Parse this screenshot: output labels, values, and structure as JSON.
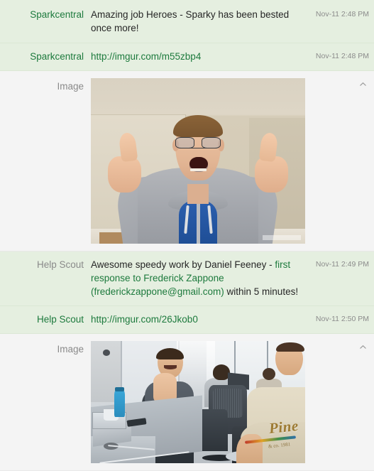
{
  "feed": {
    "rows": [
      {
        "type": "text",
        "source": "Sparkcentral",
        "source_color": "green",
        "message": "Amazing job Heroes - Sparky has been bested once more!",
        "timestamp": "Nov-11 2:48 PM"
      },
      {
        "type": "text",
        "source": "Sparkcentral",
        "source_color": "green",
        "link": "http://imgur.com/m55zbp4",
        "timestamp": "Nov-11 2:48 PM"
      },
      {
        "type": "image",
        "label": "Image",
        "alt": "Man in gray hoodie and blue shirt with glasses giving two thumbs up, mouth open in excitement, beige wall behind",
        "collapse_icon": "chevron-up-icon"
      },
      {
        "type": "text",
        "source": "Help Scout",
        "source_color": "gray",
        "message_part_1": "Awesome speedy work by Daniel Feeney - ",
        "message_link": "first response to Frederick Zappone (frederickzappone@gmail.com)",
        "message_part_2": " within 5 minutes!",
        "timestamp": "Nov-11 2:49 PM"
      },
      {
        "type": "text",
        "source": "Help Scout",
        "source_color": "green",
        "link": "http://imgur.com/26Jkob0",
        "timestamp": "Nov-11 2:50 PM"
      },
      {
        "type": "image",
        "label": "Image",
        "alt": "Open plan office, man in dark gray t-shirt clapping and smiling at a desk with laptops and a blue water bottle, office chairs, man in cream Pine t-shirt in the foreground right",
        "collapse_icon": "chevron-up-icon"
      }
    ]
  },
  "photo2_text": {
    "graphic_word": "Pine",
    "graphic_sub": "& co. 1981"
  },
  "colors": {
    "row_background_text": "#e5efe0",
    "row_background_image": "#f4f4f4",
    "link_green": "#1d7a3d",
    "source_green": "#1d7a3d",
    "source_gray": "#8a8a8a",
    "body_text": "#262626",
    "timestamp_gray": "#8c8c8c"
  }
}
